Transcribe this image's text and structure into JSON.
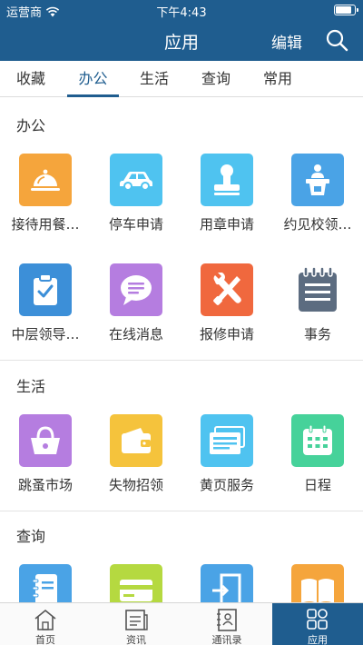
{
  "status_bar": {
    "carrier": "运营商",
    "time": "下午4:43",
    "battery_level": 0.9
  },
  "nav": {
    "title": "应用",
    "edit_label": "编辑"
  },
  "tabs": [
    {
      "label": "收藏",
      "active": false
    },
    {
      "label": "办公",
      "active": true
    },
    {
      "label": "生活",
      "active": false
    },
    {
      "label": "查询",
      "active": false
    },
    {
      "label": "常用",
      "active": false
    }
  ],
  "sections": {
    "office": {
      "title": "办公",
      "items": [
        {
          "label": "接待用餐…",
          "icon": "dome-cloche-icon",
          "color": "#f5a53c"
        },
        {
          "label": "停车申请",
          "icon": "car-icon",
          "color": "#4fc3f0"
        },
        {
          "label": "用章申请",
          "icon": "stamp-icon",
          "color": "#4fc3f0"
        },
        {
          "label": "约见校领…",
          "icon": "podium-icon",
          "color": "#4aa3e6"
        },
        {
          "label": "中层领导…",
          "icon": "clipboard-check-icon",
          "color": "#3c8fd8"
        },
        {
          "label": "在线消息",
          "icon": "chat-bubble-icon",
          "color": "#b57de0"
        },
        {
          "label": "报修申请",
          "icon": "tools-icon",
          "color": "#f0683e"
        },
        {
          "label": "事务",
          "icon": "notepad-icon",
          "color": "#5c6c80"
        }
      ]
    },
    "life": {
      "title": "生活",
      "items": [
        {
          "label": "跳蚤市场",
          "icon": "basket-icon",
          "color": "#b57de0"
        },
        {
          "label": "失物招领",
          "icon": "wallet-icon",
          "color": "#f5c33c"
        },
        {
          "label": "黄页服务",
          "icon": "address-card-icon",
          "color": "#4fc3f0"
        },
        {
          "label": "日程",
          "icon": "calendar-icon",
          "color": "#46d29a"
        }
      ]
    },
    "query": {
      "title": "查询",
      "items": [
        {
          "label": "",
          "icon": "address-book-icon",
          "color": "#4aa3e6"
        },
        {
          "label": "",
          "icon": "credit-card-icon",
          "color": "#b5d940"
        },
        {
          "label": "",
          "icon": "door-exit-icon",
          "color": "#4aa3e6"
        },
        {
          "label": "",
          "icon": "open-book-icon",
          "color": "#f5a53c"
        }
      ]
    }
  },
  "bottom_tabs": [
    {
      "label": "首页",
      "icon": "home-icon",
      "active": false
    },
    {
      "label": "资讯",
      "icon": "news-icon",
      "active": false
    },
    {
      "label": "通讯录",
      "icon": "contacts-icon",
      "active": false
    },
    {
      "label": "应用",
      "icon": "apps-grid-icon",
      "active": true
    }
  ],
  "colors": {
    "primary": "#1f5d8f",
    "divider": "#e3e3e3"
  }
}
